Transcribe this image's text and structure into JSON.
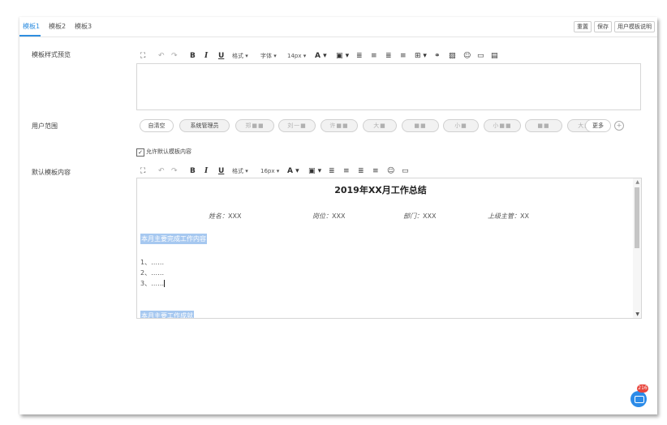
{
  "tabs": [
    {
      "label": "模板1",
      "active": true
    },
    {
      "label": "模板2",
      "active": false
    },
    {
      "label": "模板3",
      "active": false
    }
  ],
  "toolbar_buttons": {
    "reset": "重置",
    "save": "保存",
    "help": "用户模板说明"
  },
  "sections": {
    "preview_label": "模板样式预览",
    "users_label": "用户范围",
    "default_label": "默认模板内容"
  },
  "editor_toolbar_1": {
    "format": "格式",
    "font": "字体",
    "size": "14px"
  },
  "editor_toolbar_2": {
    "format": "格式",
    "size": "16px"
  },
  "user_chips": [
    {
      "label": "自清空",
      "blurred": false
    },
    {
      "label": "系统管理员",
      "blurred": false
    },
    {
      "label": "郑■■",
      "blurred": true
    },
    {
      "label": "刘一■",
      "blurred": true
    },
    {
      "label": "许■■",
      "blurred": true
    },
    {
      "label": "大■",
      "blurred": true
    },
    {
      "label": "■■",
      "blurred": true
    },
    {
      "label": "小■",
      "blurred": true
    },
    {
      "label": "小■■",
      "blurred": true
    },
    {
      "label": "■■",
      "blurred": true
    },
    {
      "label": "大■",
      "blurred": true
    },
    {
      "label": "更多",
      "blurred": false
    }
  ],
  "allow_default": {
    "label": "允许默认模板内容",
    "checked": true
  },
  "document": {
    "title": "2019年XX月工作总结",
    "fields": [
      {
        "label": "姓名：",
        "value": "XXX"
      },
      {
        "label": "岗位：",
        "value": "XXX"
      },
      {
        "label": "部门：",
        "value": "XXX"
      },
      {
        "label": "上级主管：",
        "value": "XX"
      }
    ],
    "section1": "本月主要完成工作内容",
    "items": [
      "1、……",
      "2、……",
      "3、……"
    ],
    "section2": "本月主要工作成就"
  },
  "chat": {
    "badge": "216"
  },
  "colors": {
    "accent": "#2f8ee0",
    "highlight": "#a6c8f0",
    "badge": "#e8453c"
  }
}
